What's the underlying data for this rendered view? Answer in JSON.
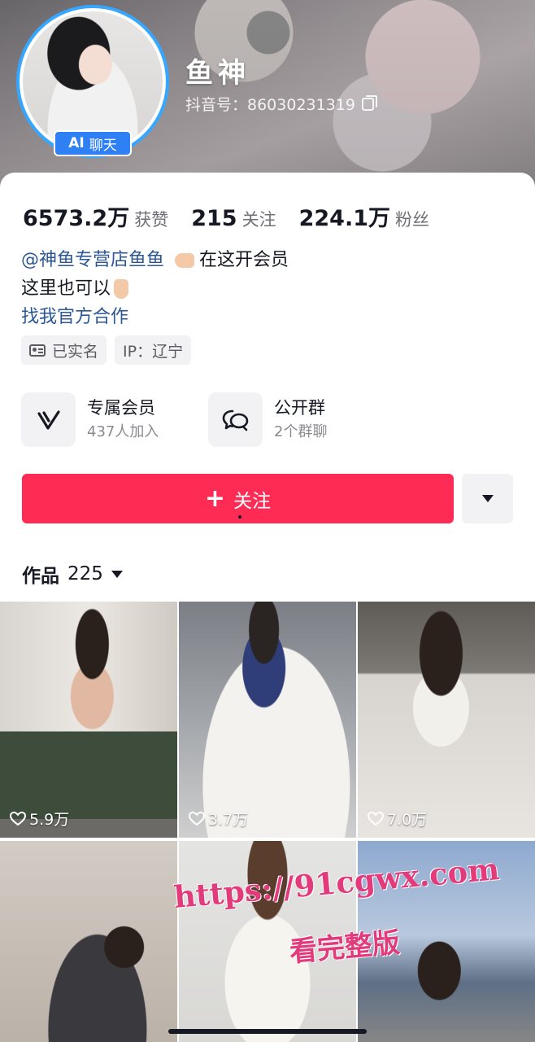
{
  "profile": {
    "nickname": "鱼神",
    "douyin_id": "抖音号：86030231319",
    "ai_badge_ai": "AI",
    "ai_badge_label": "聊天"
  },
  "stats": [
    {
      "value": "6573.2万",
      "label": "获赞"
    },
    {
      "value": "215",
      "label": "关注"
    },
    {
      "value": "224.1万",
      "label": "粉丝"
    }
  ],
  "bio": {
    "mention": "@神鱼专营店鱼鱼",
    "line1_rest": "在这开会员",
    "line2": "这里也可以",
    "link": "找我官方合作"
  },
  "tags": {
    "verified": "已实名",
    "ip": "IP：辽宁"
  },
  "features": [
    {
      "title": "专属会员",
      "subtitle": "437人加入",
      "icon": "vip-v-icon"
    },
    {
      "title": "公开群",
      "subtitle": "2个群聊",
      "icon": "group-chat-icon"
    }
  ],
  "follow": {
    "label": "关注",
    "accent_color": "#fe2c55"
  },
  "works": {
    "label": "作品",
    "count": "225",
    "items": [
      {
        "likes": "5.9万"
      },
      {
        "likes": "3.7万"
      },
      {
        "likes": "7.0万"
      },
      {
        "likes": ""
      },
      {
        "likes": ""
      },
      {
        "likes": ""
      }
    ]
  },
  "watermark": {
    "url": "https://91cgwx.com",
    "subtitle": "看完整版",
    "color": "#e23a7a"
  }
}
